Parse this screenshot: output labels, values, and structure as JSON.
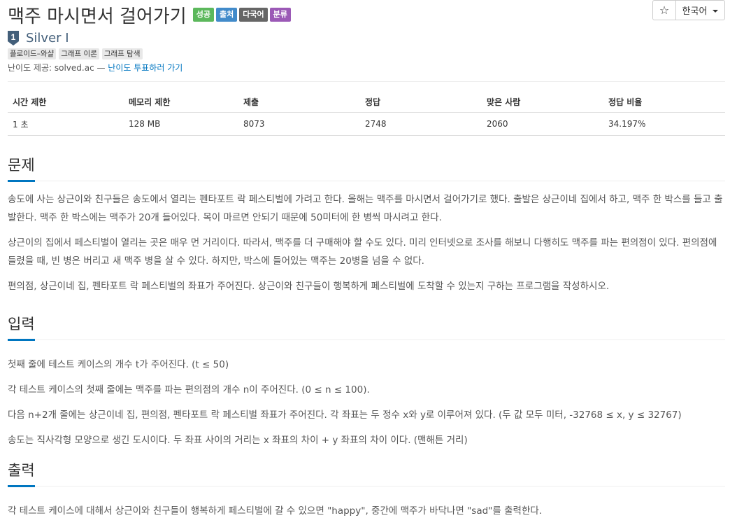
{
  "header": {
    "title": "맥주 마시면서 걸어가기",
    "labels": {
      "success": "성공",
      "source": "출처",
      "multilang": "다국어",
      "category": "분류"
    },
    "star": "☆",
    "language": "한국어"
  },
  "tier": {
    "text": "Silver I",
    "badge": "1"
  },
  "tags": [
    "플로이드–와샬",
    "그래프 이론",
    "그래프 탐색"
  ],
  "difficulty": {
    "prefix": "난이도 제공: solved.ac — ",
    "link": "난이도 투표하러 가기"
  },
  "info_table": {
    "headers": [
      "시간 제한",
      "메모리 제한",
      "제출",
      "정답",
      "맞은 사람",
      "정답 비율"
    ],
    "values": [
      "1 초",
      "128 MB",
      "8073",
      "2748",
      "2060",
      "34.197%"
    ]
  },
  "problem": {
    "title": "문제",
    "paragraphs": [
      "송도에 사는 상근이와 친구들은 송도에서 열리는 펜타포트 락 페스티벌에 가려고 한다. 올해는 맥주를 마시면서 걸어가기로 했다. 출발은 상근이네 집에서 하고, 맥주 한 박스를 들고 출발한다. 맥주 한 박스에는 맥주가 20개 들어있다. 목이 마르면 안되기 때문에 50미터에 한 병씩 마시려고 한다.",
      "상근이의 집에서 페스티벌이 열리는 곳은 매우 먼 거리이다. 따라서, 맥주를 더 구매해야 할 수도 있다. 미리 인터넷으로 조사를 해보니 다행히도 맥주를 파는 편의점이 있다. 편의점에 들렸을 때, 빈 병은 버리고 새 맥주 병을 살 수 있다. 하지만, 박스에 들어있는 맥주는 20병을 넘을 수 없다.",
      "편의점, 상근이네 집, 펜타포트 락 페스티벌의 좌표가 주어진다. 상근이와 친구들이 행복하게 페스티벌에 도착할 수 있는지 구하는 프로그램을 작성하시오."
    ]
  },
  "input": {
    "title": "입력",
    "paragraphs": [
      "첫째 줄에 테스트 케이스의 개수 t가 주어진다. (t ≤ 50)",
      "각 테스트 케이스의 첫째 줄에는 맥주를 파는 편의점의 개수 n이 주어진다. (0 ≤ n ≤ 100).",
      "다음 n+2개 줄에는 상근이네 집, 편의점, 펜타포트 락 페스티벌 좌표가 주어진다. 각 좌표는 두 정수 x와 y로 이루어져 있다. (두 값 모두 미터, -32768 ≤ x, y ≤ 32767)",
      "송도는 직사각형 모양으로 생긴 도시이다. 두 좌표 사이의 거리는 x 좌표의 차이 + y 좌표의 차이 이다. (맨해튼 거리)"
    ]
  },
  "output": {
    "title": "출력",
    "paragraphs": [
      "각 테스트 케이스에 대해서 상근이와 친구들이 행복하게 페스티벌에 갈 수 있으면 \"happy\", 중간에 맥주가 바닥나면 \"sad\"를 출력한다."
    ]
  },
  "colors": {
    "success": "#5cb85c",
    "source": "#428bca",
    "multilang": "#666666",
    "category": "#9b59b6",
    "accent": "#0076c0",
    "tier": "#435f7a"
  }
}
